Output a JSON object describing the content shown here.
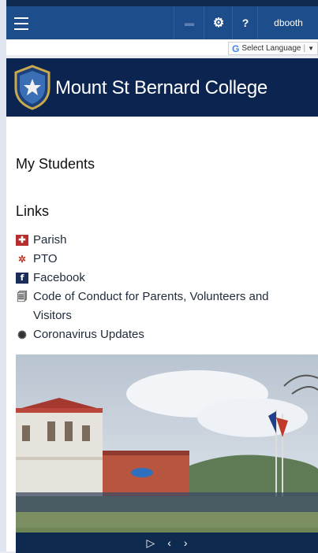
{
  "topbar": {
    "menu_icon": "hamburger-icon",
    "settings_icon": "gear-icon",
    "help_label": "?",
    "user_label": "dbooth",
    "accent_color": "#1e4d8c"
  },
  "language": {
    "label": "Select Language",
    "icon": "google-g-icon"
  },
  "header": {
    "college_name": "Mount St Bernard College",
    "background_color": "#0b2550"
  },
  "sections": {
    "my_students": "My Students",
    "links_title": "Links"
  },
  "links": [
    {
      "label": "Parish",
      "icon": "parish-icon"
    },
    {
      "label": "PTO",
      "icon": "pto-icon"
    },
    {
      "label": "Facebook",
      "icon": "facebook-icon"
    },
    {
      "label": "Code of Conduct for Parents, Volunteers and Visitors",
      "icon": "document-icon"
    },
    {
      "label": "Coronavirus Updates",
      "icon": "virus-icon"
    }
  ],
  "slideshow": {
    "controls": {
      "play": "▷",
      "prev": "‹",
      "next": "›"
    }
  }
}
